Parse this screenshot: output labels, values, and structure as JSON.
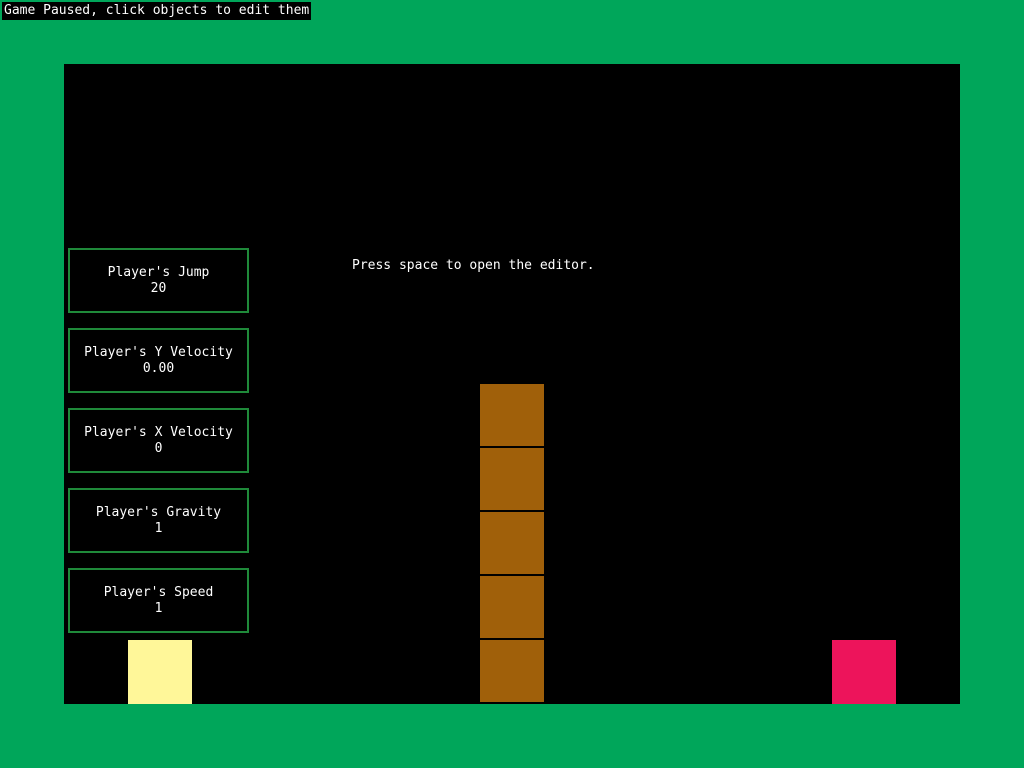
{
  "status": {
    "message": "Game Paused, click objects to edit them"
  },
  "hint": {
    "text": "Press space to open the editor."
  },
  "stats": [
    {
      "label": "Player's Jump",
      "value": "20"
    },
    {
      "label": "Player's Y Velocity",
      "value": "0.00"
    },
    {
      "label": "Player's X Velocity",
      "value": "0"
    },
    {
      "label": "Player's Gravity",
      "value": "1"
    },
    {
      "label": "Player's Speed",
      "value": "1"
    }
  ],
  "colors": {
    "background": "#00a65a",
    "canvas": "#000000",
    "player": "#fff799",
    "block": "#a0600a",
    "goal": "#ed145b",
    "panel_border": "#1f8a3a"
  }
}
